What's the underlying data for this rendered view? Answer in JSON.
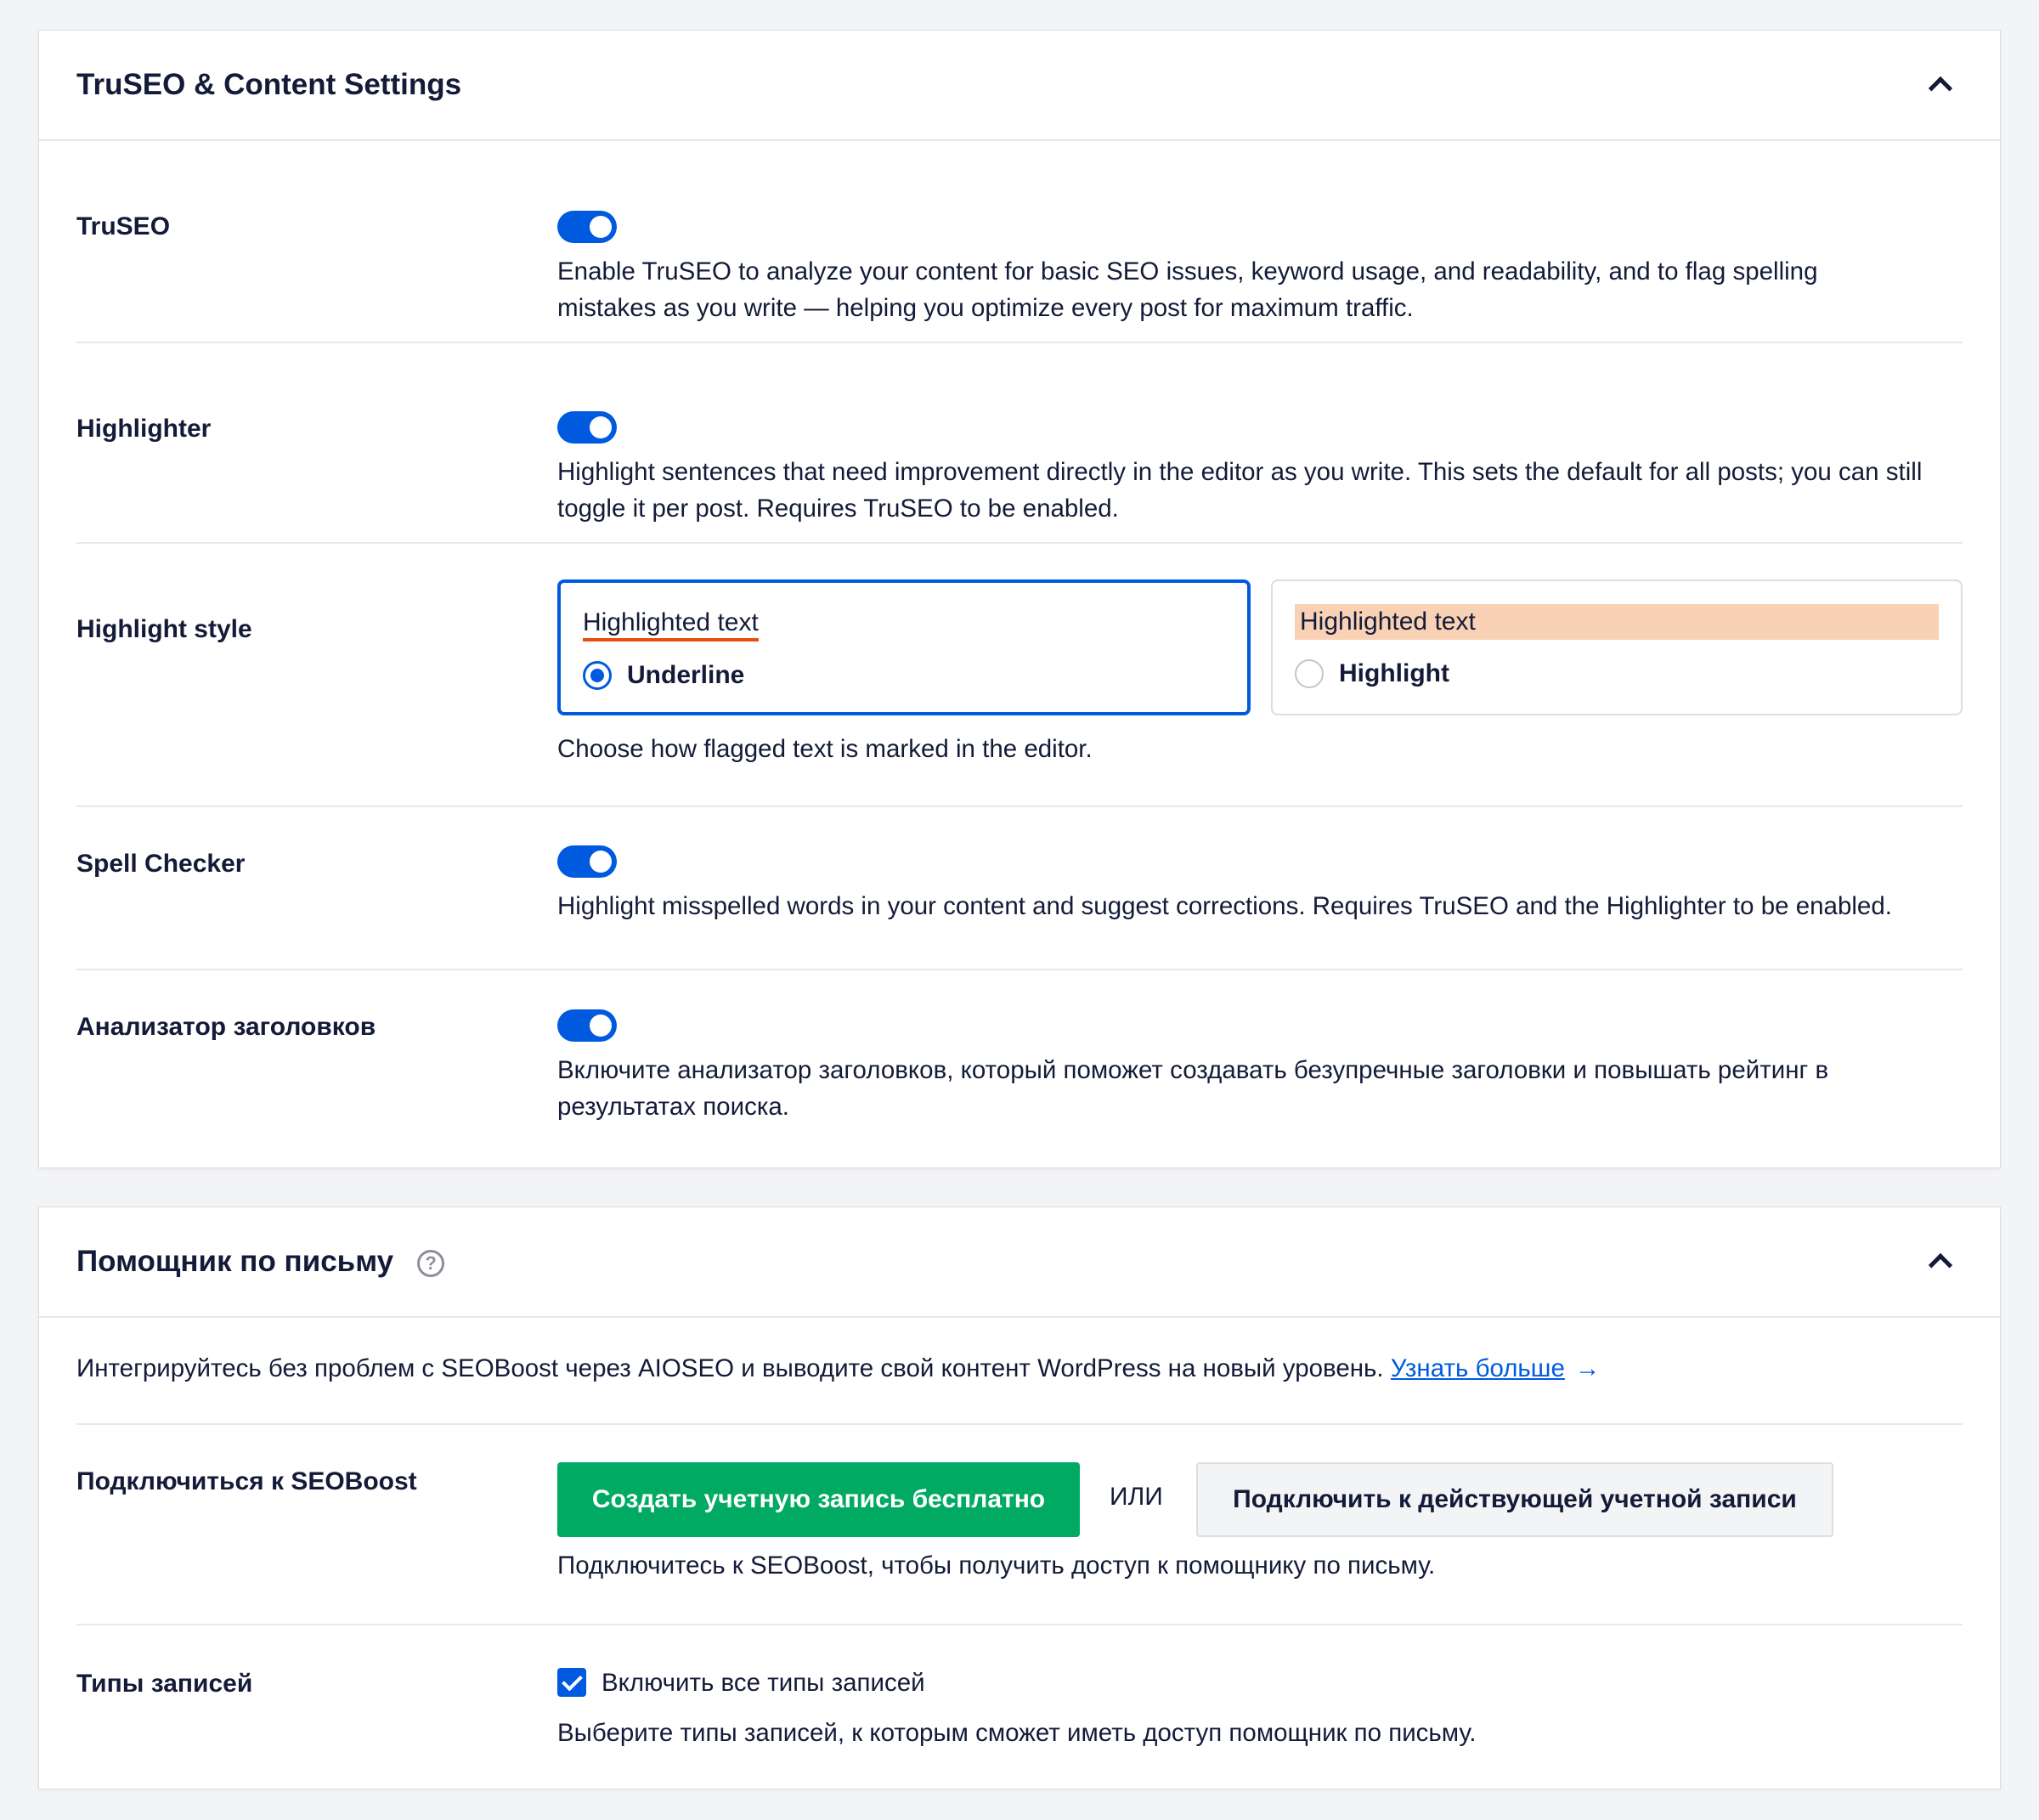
{
  "section1": {
    "title": "TruSEO & Content Settings",
    "rows": {
      "truseo": {
        "label": "TruSEO",
        "enabled": true,
        "description": "Enable TruSEO to analyze your content for basic SEO issues, keyword usage, and readability, and to flag spelling mistakes as you write — helping you optimize every post for maximum traffic."
      },
      "highlighter": {
        "label": "Highlighter",
        "enabled": true,
        "description": "Highlight sentences that need improvement directly in the editor as you write. This sets the default for all posts; you can still toggle it per post. Requires TruSEO to be enabled."
      },
      "highlight_style": {
        "label": "Highlight style",
        "options": [
          {
            "sample": "Highlighted text",
            "label": "Underline",
            "selected": true
          },
          {
            "sample": "Highlighted text",
            "label": "Highlight",
            "selected": false
          }
        ],
        "description": "Choose how flagged text is marked in the editor."
      },
      "spell_checker": {
        "label": "Spell Checker",
        "enabled": true,
        "description": "Highlight misspelled words in your content and suggest corrections. Requires TruSEO and the Highlighter to be enabled."
      },
      "headline_analyzer": {
        "label": "Анализатор заголовков",
        "enabled": true,
        "description": "Включите анализатор заголовков, который поможет создавать безупречные заголовки и повышать рейтинг в результатах поиска."
      }
    }
  },
  "section2": {
    "title": "Помощник по письму",
    "intro": "Интегрируйтесь без проблем с SEOBoost через AIOSEO и выводите свой контент WordPress на новый уровень.",
    "learn_more": "Узнать больше",
    "learn_more_arrow": "→",
    "rows": {
      "connect": {
        "label": "Подключиться к SEOBoost",
        "create_button": "Создать учетную запись бесплатно",
        "or": "ИЛИ",
        "connect_button": "Подключить к действующей учетной записи",
        "description": "Подключитесь к SEOBoost, чтобы получить доступ к помощнику по письму."
      },
      "post_types": {
        "label": "Типы записей",
        "checkbox_label": "Включить все типы записей",
        "checked": true,
        "description": "Выберите типы записей, к которым сможет иметь доступ помощник по письму."
      }
    }
  },
  "colors": {
    "accent": "#005ae0",
    "green": "#00aa63",
    "underline": "#e94e0f",
    "highlight": "#f9d2b5"
  }
}
